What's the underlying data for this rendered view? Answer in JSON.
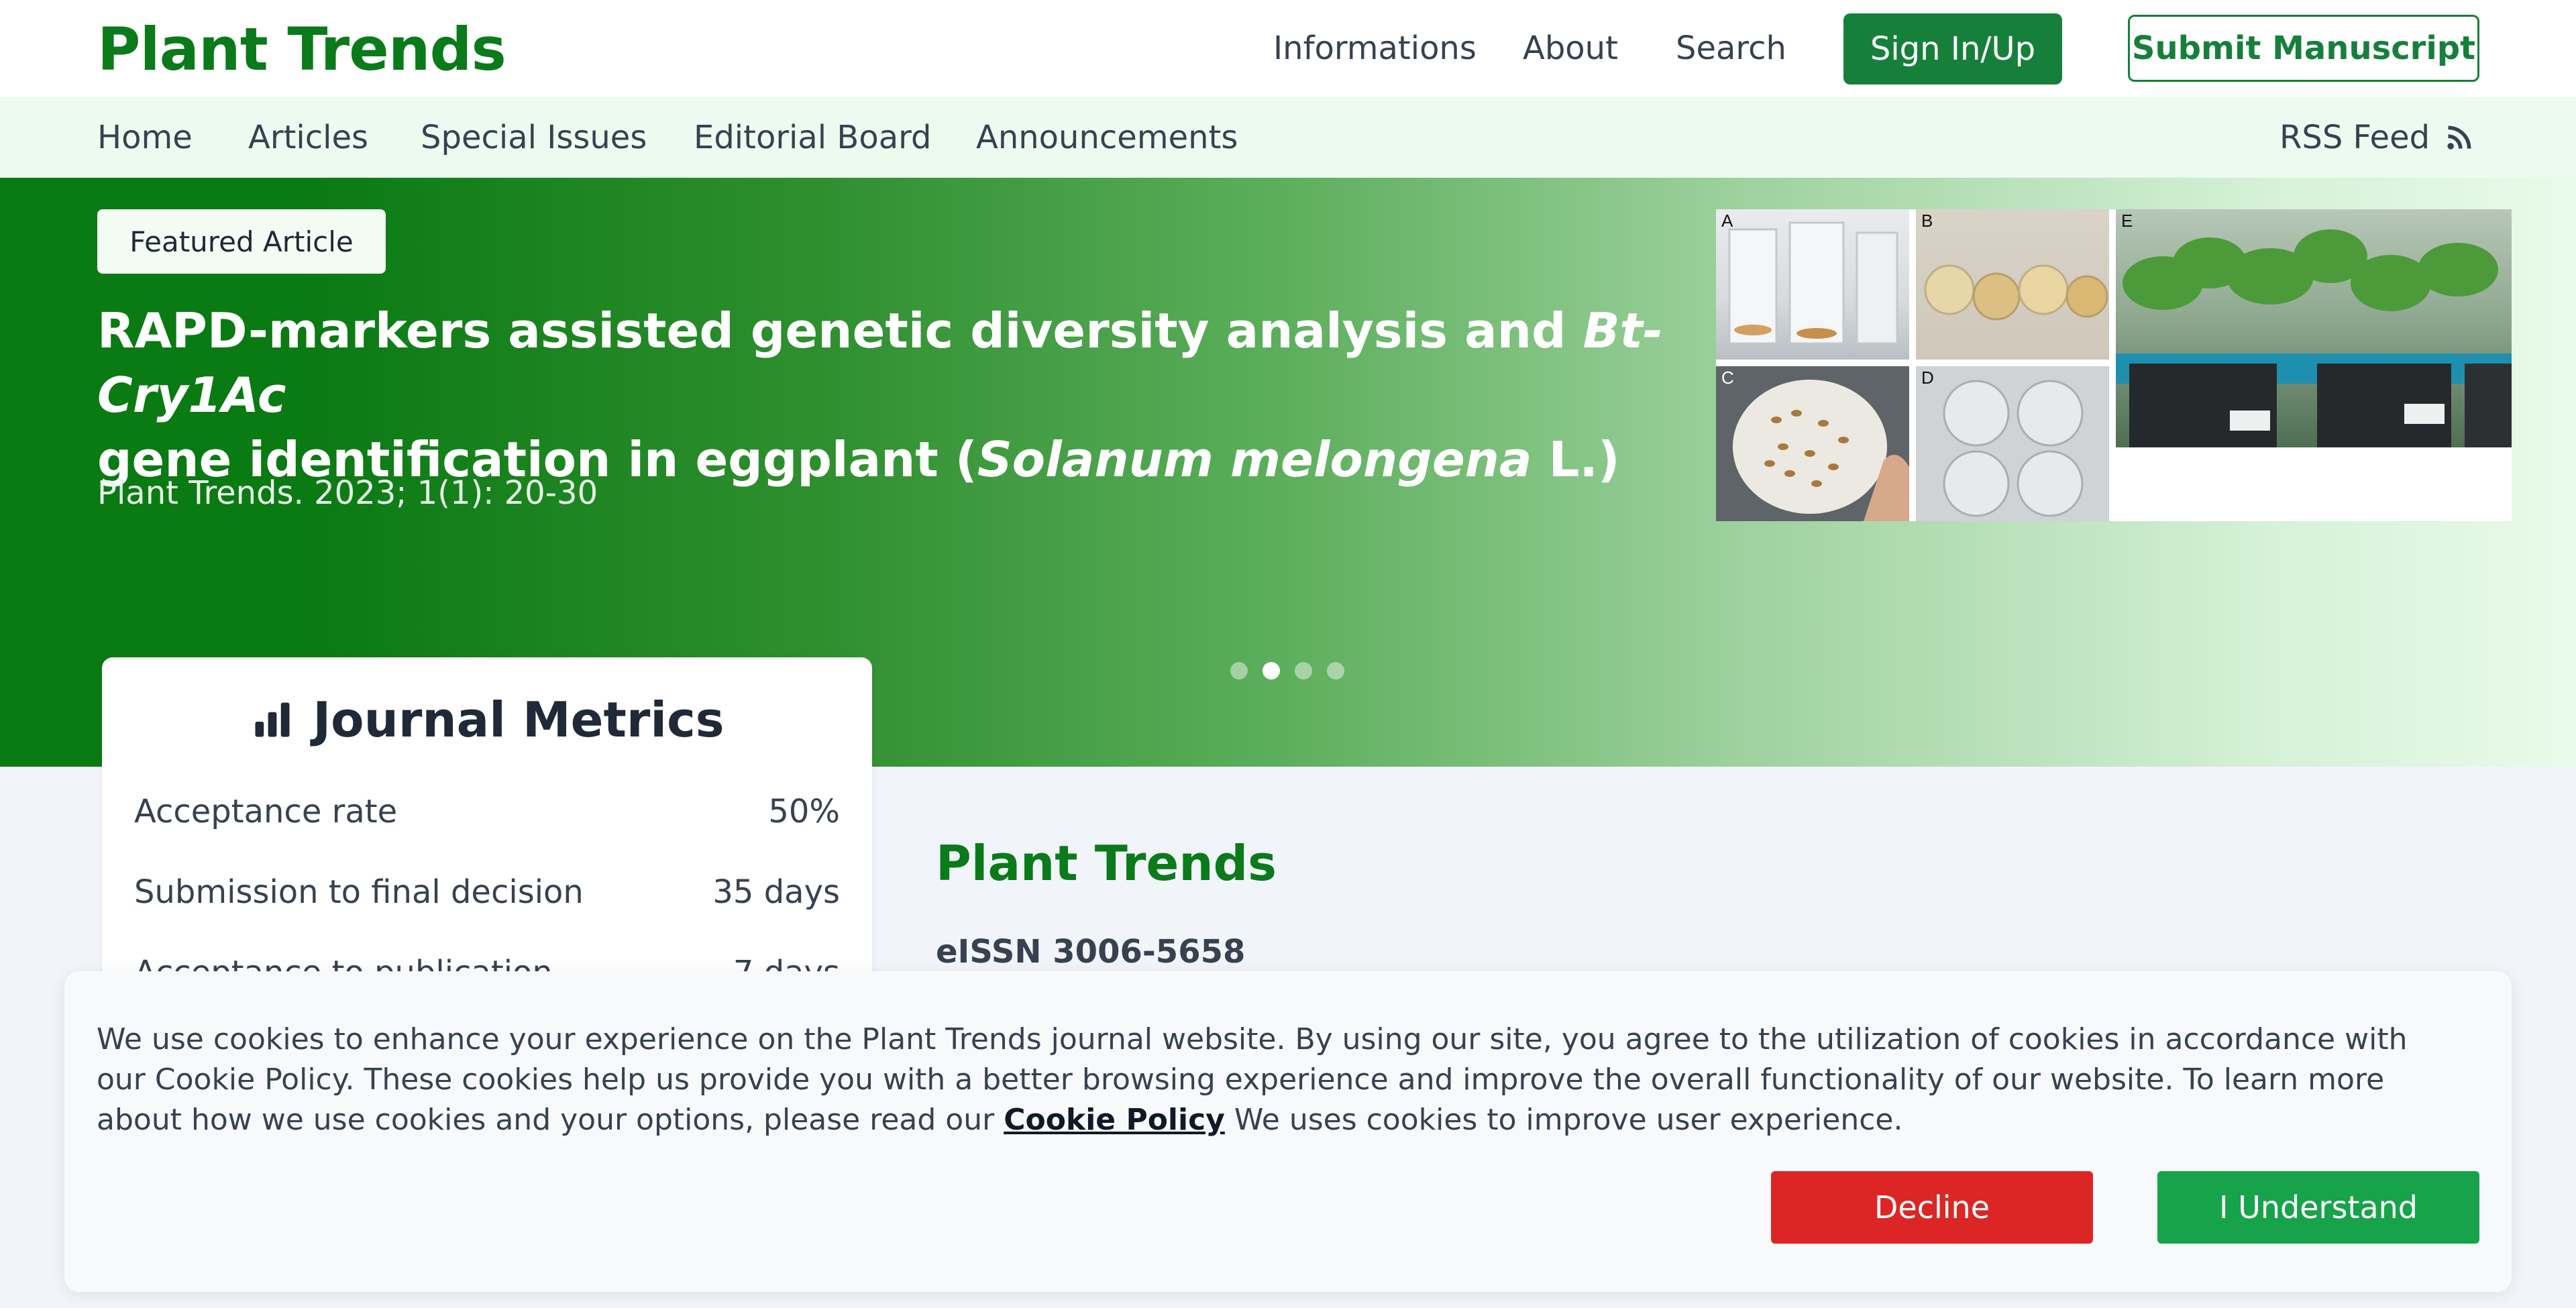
{
  "header": {
    "brand": "Plant Trends",
    "nav": [
      "Informations",
      "About",
      "Search"
    ],
    "signin_label": "Sign In/Up",
    "submit_label": "Submit Manuscript"
  },
  "subnav": {
    "items": [
      "Home",
      "Articles",
      "Special Issues",
      "Editorial Board",
      "Announcements"
    ],
    "rss_label": "RSS Feed"
  },
  "hero": {
    "badge": "Featured Article",
    "title_part1": "RAPD-markers assisted genetic diversity analysis and ",
    "title_italic1": "Bt-Cry1Ac",
    "title_part2": "gene identification in eggplant (",
    "title_italic2": "Solanum melongena",
    "title_part3": " L.)",
    "citation": "Plant Trends. 2023; 1(1): 20-30",
    "figure_panels": [
      "A",
      "B",
      "C",
      "D",
      "E"
    ],
    "slide_count": 4,
    "active_slide": 2
  },
  "metrics": {
    "title": "Journal Metrics",
    "rows": [
      {
        "label": "Acceptance rate",
        "value": "50%"
      },
      {
        "label": "Submission to final decision",
        "value": "35 days"
      },
      {
        "label": "Acceptance to publication",
        "value": "7 days"
      }
    ]
  },
  "journal": {
    "name": "Plant Trends",
    "issn": "eISSN 3006-5658"
  },
  "cookie": {
    "text": "We use cookies to enhance your experience on the Plant Trends  journal website. By using our site, you agree to the utilization of cookies in accordance with our Cookie Policy. These cookies help us provide you with a better browsing experience and improve the overall functionality of our website. To learn more about how we use cookies and your options, please read our ",
    "link": "Cookie Policy",
    "text_after": " We uses cookies to improve user experience.",
    "decline_label": "Decline",
    "accept_label": "I Understand"
  },
  "colors": {
    "brand_green": "#0b7a1a",
    "button_green": "#16803a",
    "decline_red": "#dc2626",
    "accept_green": "#16a34a"
  }
}
